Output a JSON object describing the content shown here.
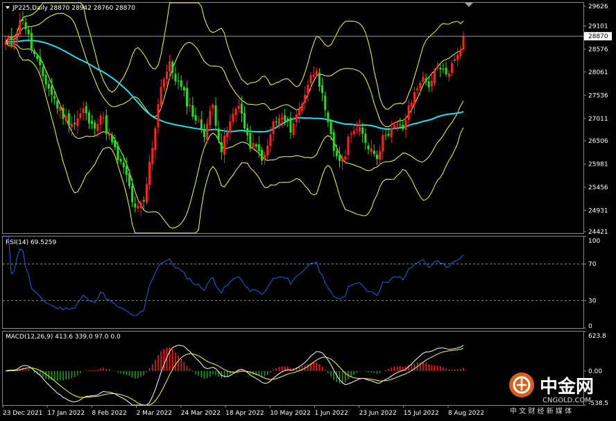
{
  "header": {
    "symbol_line": "JP225,Daily  28870 28942 28760 28870",
    "rsi_label": "RSI(14) 69.5259",
    "macd_label": "MACD(12,26,9) 413.6 339.0 97.0 0.0"
  },
  "price_axis": {
    "ticks": [
      "29626",
      "29101",
      "28576",
      "28061",
      "27536",
      "27011",
      "26506",
      "25981",
      "25456",
      "24931",
      "24421"
    ],
    "current_price_label": "28870",
    "current_price": 28870,
    "range": [
      24421,
      29626
    ]
  },
  "rsi_axis": {
    "ticks": [
      "100",
      "70",
      "30",
      "0"
    ],
    "levels": [
      70,
      30
    ],
    "range": [
      0,
      100
    ]
  },
  "macd_axis": {
    "ticks": [
      "623.8",
      "0.00",
      "-538.5"
    ],
    "range": [
      -538.5,
      623.8
    ]
  },
  "date_axis": {
    "labels": [
      "23 Dec 2021",
      "17 Jan 2022",
      "8 Feb 2022",
      "2 Mar 2022",
      "24 Mar 2022",
      "18 Apr 2022",
      "10 May 2022",
      "1 Jun 2022",
      "23 Jun 2022",
      "15 Jul 2022",
      "8 Aug 2022"
    ]
  },
  "watermark": {
    "brand_cn": "中金网",
    "url": "CNGOLD.COM",
    "tagline_cn": "中 文 财 经 新 媒 体"
  },
  "colors": {
    "background": "#000000",
    "candle_up": "#ff2020",
    "candle_down": "#22e01a",
    "ma": "#22e0ee",
    "bollinger": "#ffff33",
    "rsi_line": "#2a5fe8",
    "macd_line": "#ffffff",
    "signal_line": "#ffff33",
    "hist_up": "#ff2020",
    "hist_down": "#1fa31a",
    "grid": "#8a8a8a"
  },
  "chart_data": {
    "type": "candlestick",
    "close_anchors": [
      [
        0,
        28700
      ],
      [
        3,
        28900
      ],
      [
        6,
        29300
      ],
      [
        9,
        28600
      ],
      [
        12,
        28100
      ],
      [
        15,
        27700
      ],
      [
        18,
        27300
      ],
      [
        21,
        27000
      ],
      [
        24,
        26900
      ],
      [
        27,
        27200
      ],
      [
        30,
        26800
      ],
      [
        33,
        27100
      ],
      [
        36,
        26600
      ],
      [
        39,
        26100
      ],
      [
        42,
        25700
      ],
      [
        45,
        24900
      ],
      [
        48,
        25100
      ],
      [
        51,
        26400
      ],
      [
        54,
        27800
      ],
      [
        57,
        28200
      ],
      [
        60,
        27800
      ],
      [
        63,
        27400
      ],
      [
        66,
        27000
      ],
      [
        69,
        26700
      ],
      [
        72,
        27300
      ],
      [
        75,
        26300
      ],
      [
        78,
        26900
      ],
      [
        81,
        27400
      ],
      [
        84,
        26500
      ],
      [
        87,
        26300
      ],
      [
        90,
        26100
      ],
      [
        93,
        26900
      ],
      [
        96,
        27000
      ],
      [
        99,
        26800
      ],
      [
        102,
        27200
      ],
      [
        105,
        27800
      ],
      [
        108,
        28200
      ],
      [
        111,
        27100
      ],
      [
        114,
        26300
      ],
      [
        117,
        26000
      ],
      [
        120,
        26800
      ],
      [
        123,
        26700
      ],
      [
        126,
        26400
      ],
      [
        129,
        26200
      ],
      [
        132,
        26700
      ],
      [
        135,
        26800
      ],
      [
        138,
        26800
      ],
      [
        141,
        27400
      ],
      [
        144,
        27900
      ],
      [
        147,
        27800
      ],
      [
        150,
        28100
      ],
      [
        153,
        28000
      ],
      [
        156,
        28300
      ],
      [
        159,
        28870
      ]
    ],
    "bollinger_period": 20,
    "bollinger_deviations": [
      1,
      2
    ],
    "ma_period": 50,
    "rsi_period": 14,
    "macd_params": [
      12,
      26,
      9
    ]
  }
}
